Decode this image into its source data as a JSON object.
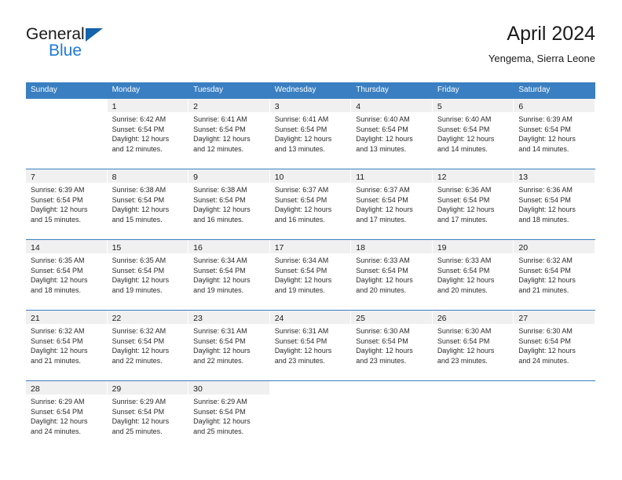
{
  "brand": {
    "name_part1": "General",
    "name_part2": "Blue",
    "accent_color": "#1e7ad4",
    "triangle_color": "#1463ad"
  },
  "header": {
    "title": "April 2024",
    "subtitle": "Yengema, Sierra Leone"
  },
  "theme": {
    "header_row_bg": "#3a7fc1",
    "daynum_band_bg": "#f0f0f0",
    "text_color": "#1a1a1a"
  },
  "weekdays": [
    "Sunday",
    "Monday",
    "Tuesday",
    "Wednesday",
    "Thursday",
    "Friday",
    "Saturday"
  ],
  "weeks": [
    [
      {
        "day": "",
        "lines": [
          "",
          "",
          "",
          ""
        ]
      },
      {
        "day": "1",
        "lines": [
          "Sunrise: 6:42 AM",
          "Sunset: 6:54 PM",
          "Daylight: 12 hours",
          "and 12 minutes."
        ]
      },
      {
        "day": "2",
        "lines": [
          "Sunrise: 6:41 AM",
          "Sunset: 6:54 PM",
          "Daylight: 12 hours",
          "and 12 minutes."
        ]
      },
      {
        "day": "3",
        "lines": [
          "Sunrise: 6:41 AM",
          "Sunset: 6:54 PM",
          "Daylight: 12 hours",
          "and 13 minutes."
        ]
      },
      {
        "day": "4",
        "lines": [
          "Sunrise: 6:40 AM",
          "Sunset: 6:54 PM",
          "Daylight: 12 hours",
          "and 13 minutes."
        ]
      },
      {
        "day": "5",
        "lines": [
          "Sunrise: 6:40 AM",
          "Sunset: 6:54 PM",
          "Daylight: 12 hours",
          "and 14 minutes."
        ]
      },
      {
        "day": "6",
        "lines": [
          "Sunrise: 6:39 AM",
          "Sunset: 6:54 PM",
          "Daylight: 12 hours",
          "and 14 minutes."
        ]
      }
    ],
    [
      {
        "day": "7",
        "lines": [
          "Sunrise: 6:39 AM",
          "Sunset: 6:54 PM",
          "Daylight: 12 hours",
          "and 15 minutes."
        ]
      },
      {
        "day": "8",
        "lines": [
          "Sunrise: 6:38 AM",
          "Sunset: 6:54 PM",
          "Daylight: 12 hours",
          "and 15 minutes."
        ]
      },
      {
        "day": "9",
        "lines": [
          "Sunrise: 6:38 AM",
          "Sunset: 6:54 PM",
          "Daylight: 12 hours",
          "and 16 minutes."
        ]
      },
      {
        "day": "10",
        "lines": [
          "Sunrise: 6:37 AM",
          "Sunset: 6:54 PM",
          "Daylight: 12 hours",
          "and 16 minutes."
        ]
      },
      {
        "day": "11",
        "lines": [
          "Sunrise: 6:37 AM",
          "Sunset: 6:54 PM",
          "Daylight: 12 hours",
          "and 17 minutes."
        ]
      },
      {
        "day": "12",
        "lines": [
          "Sunrise: 6:36 AM",
          "Sunset: 6:54 PM",
          "Daylight: 12 hours",
          "and 17 minutes."
        ]
      },
      {
        "day": "13",
        "lines": [
          "Sunrise: 6:36 AM",
          "Sunset: 6:54 PM",
          "Daylight: 12 hours",
          "and 18 minutes."
        ]
      }
    ],
    [
      {
        "day": "14",
        "lines": [
          "Sunrise: 6:35 AM",
          "Sunset: 6:54 PM",
          "Daylight: 12 hours",
          "and 18 minutes."
        ]
      },
      {
        "day": "15",
        "lines": [
          "Sunrise: 6:35 AM",
          "Sunset: 6:54 PM",
          "Daylight: 12 hours",
          "and 19 minutes."
        ]
      },
      {
        "day": "16",
        "lines": [
          "Sunrise: 6:34 AM",
          "Sunset: 6:54 PM",
          "Daylight: 12 hours",
          "and 19 minutes."
        ]
      },
      {
        "day": "17",
        "lines": [
          "Sunrise: 6:34 AM",
          "Sunset: 6:54 PM",
          "Daylight: 12 hours",
          "and 19 minutes."
        ]
      },
      {
        "day": "18",
        "lines": [
          "Sunrise: 6:33 AM",
          "Sunset: 6:54 PM",
          "Daylight: 12 hours",
          "and 20 minutes."
        ]
      },
      {
        "day": "19",
        "lines": [
          "Sunrise: 6:33 AM",
          "Sunset: 6:54 PM",
          "Daylight: 12 hours",
          "and 20 minutes."
        ]
      },
      {
        "day": "20",
        "lines": [
          "Sunrise: 6:32 AM",
          "Sunset: 6:54 PM",
          "Daylight: 12 hours",
          "and 21 minutes."
        ]
      }
    ],
    [
      {
        "day": "21",
        "lines": [
          "Sunrise: 6:32 AM",
          "Sunset: 6:54 PM",
          "Daylight: 12 hours",
          "and 21 minutes."
        ]
      },
      {
        "day": "22",
        "lines": [
          "Sunrise: 6:32 AM",
          "Sunset: 6:54 PM",
          "Daylight: 12 hours",
          "and 22 minutes."
        ]
      },
      {
        "day": "23",
        "lines": [
          "Sunrise: 6:31 AM",
          "Sunset: 6:54 PM",
          "Daylight: 12 hours",
          "and 22 minutes."
        ]
      },
      {
        "day": "24",
        "lines": [
          "Sunrise: 6:31 AM",
          "Sunset: 6:54 PM",
          "Daylight: 12 hours",
          "and 23 minutes."
        ]
      },
      {
        "day": "25",
        "lines": [
          "Sunrise: 6:30 AM",
          "Sunset: 6:54 PM",
          "Daylight: 12 hours",
          "and 23 minutes."
        ]
      },
      {
        "day": "26",
        "lines": [
          "Sunrise: 6:30 AM",
          "Sunset: 6:54 PM",
          "Daylight: 12 hours",
          "and 23 minutes."
        ]
      },
      {
        "day": "27",
        "lines": [
          "Sunrise: 6:30 AM",
          "Sunset: 6:54 PM",
          "Daylight: 12 hours",
          "and 24 minutes."
        ]
      }
    ],
    [
      {
        "day": "28",
        "lines": [
          "Sunrise: 6:29 AM",
          "Sunset: 6:54 PM",
          "Daylight: 12 hours",
          "and 24 minutes."
        ]
      },
      {
        "day": "29",
        "lines": [
          "Sunrise: 6:29 AM",
          "Sunset: 6:54 PM",
          "Daylight: 12 hours",
          "and 25 minutes."
        ]
      },
      {
        "day": "30",
        "lines": [
          "Sunrise: 6:29 AM",
          "Sunset: 6:54 PM",
          "Daylight: 12 hours",
          "and 25 minutes."
        ]
      },
      {
        "day": "",
        "lines": [
          "",
          "",
          "",
          ""
        ]
      },
      {
        "day": "",
        "lines": [
          "",
          "",
          "",
          ""
        ]
      },
      {
        "day": "",
        "lines": [
          "",
          "",
          "",
          ""
        ]
      },
      {
        "day": "",
        "lines": [
          "",
          "",
          "",
          ""
        ]
      }
    ]
  ]
}
